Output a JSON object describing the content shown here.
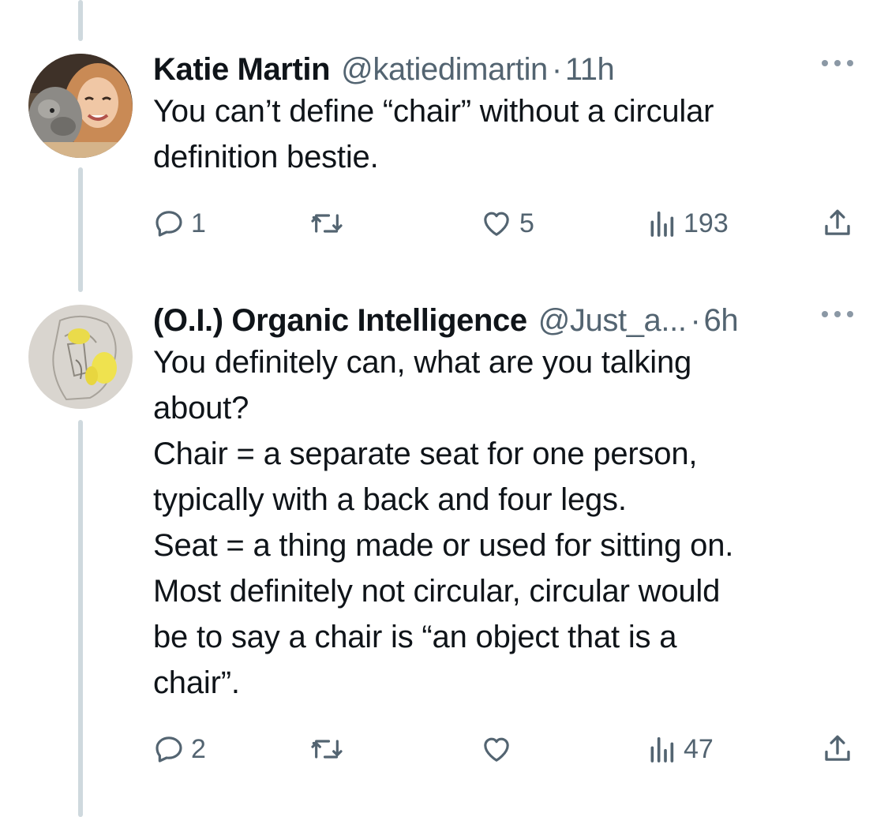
{
  "tweets": [
    {
      "display_name": "Katie Martin",
      "handle": "@katiedimartin",
      "separator": "·",
      "time": "11h",
      "lines": [
        "You can’t define “chair” without a circular",
        "definition bestie."
      ],
      "actions": {
        "replies": "1",
        "retweets": "",
        "likes": "5",
        "views": "193"
      }
    },
    {
      "display_name": "(O.I.) Organic Intelligence",
      "handle": "@Just_a...",
      "separator": "·",
      "time": "6h",
      "lines": [
        "You definitely can, what are you talking",
        "about?",
        "Chair = a separate seat for one person,",
        "typically with a back and four legs.",
        "Seat = a thing made or used for sitting on.",
        "Most definitely not circular, circular would",
        "be to say a chair is “an object that is a",
        "chair”."
      ],
      "actions": {
        "replies": "2",
        "retweets": "",
        "likes": "",
        "views": "47"
      }
    }
  ],
  "icons": {
    "reply": "reply-icon",
    "retweet": "retweet-icon",
    "like": "heart-icon",
    "views": "views-icon",
    "share": "share-icon",
    "more": "more-icon"
  },
  "colors": {
    "text": "#0f1419",
    "secondary": "#536471",
    "thread_line": "#cfd9de",
    "background": "#ffffff"
  }
}
